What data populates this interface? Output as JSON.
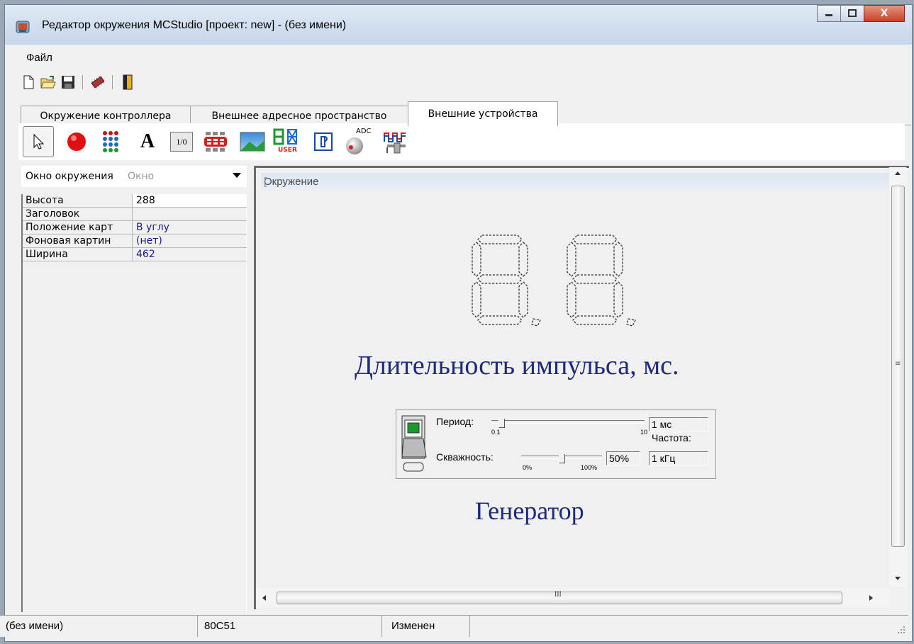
{
  "window": {
    "title": "Редактор окружения MCStudio [проект: new] - (без имени)",
    "close_label": "X"
  },
  "menu": {
    "file": "Файл"
  },
  "toolbar": {
    "icons": [
      "new-file-icon",
      "open-folder-icon",
      "save-icon",
      "chip-icon",
      "exit-door-icon"
    ]
  },
  "tabs": [
    {
      "label": "Окружение контроллера"
    },
    {
      "label": "Внешнее адресное пространство"
    },
    {
      "label": "Внешние устройства",
      "active": true
    }
  ],
  "device_toolbar": {
    "icons": [
      "pointer-icon",
      "led-icon",
      "led-matrix-icon",
      "text-label-icon",
      "io-port-icon",
      "keypad-icon",
      "image-icon",
      "seven-segment-user-icon",
      "button-device-icon",
      "adc-knob-icon",
      "pulse-generator-icon"
    ],
    "io_label": "1/0",
    "adc_label": "ADC",
    "user_label": "USER",
    "text_label": "A"
  },
  "object_selector": {
    "selected": "Окно окружения",
    "type": "Окно"
  },
  "properties": [
    {
      "name": "Высота",
      "value": "288"
    },
    {
      "name": "Заголовок",
      "value": ""
    },
    {
      "name": "Положение карт",
      "value": "В углу"
    },
    {
      "name": "Фоновая картин",
      "value": "(нет)"
    },
    {
      "name": "Ширина",
      "value": "462"
    }
  ],
  "environment": {
    "title": "Окружение",
    "edge_mark": "[",
    "caption_main": "Длительность импульса, мс.",
    "caption_generator": "Генератор",
    "generator": {
      "period_label": "Период:",
      "period_min": "0.1",
      "period_max": "10",
      "period_value": "1 мс",
      "period_fraction": 0.05,
      "frequency_label": "Частота:",
      "frequency_value": "1 кГц",
      "duty_label": "Скважность:",
      "duty_min": "0%",
      "duty_max": "100%",
      "duty_value": "50%",
      "duty_fraction": 0.5
    },
    "hscroll_grip": "III",
    "vscroll_grip": "≡"
  },
  "status": {
    "file": "(без имени)",
    "chip": "80C51",
    "state": "Изменен"
  }
}
